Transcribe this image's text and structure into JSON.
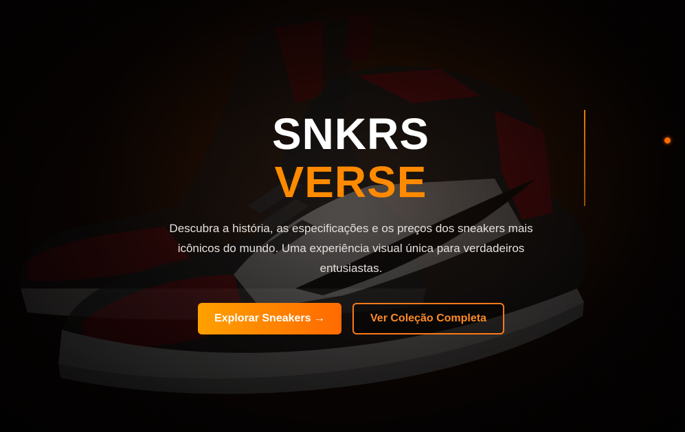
{
  "hero": {
    "title_line1": "SNKRS",
    "title_line2": "VERSE",
    "description": "Descubra a história, as especificações e os preços dos sneakers mais icônicos do mundo. Uma experiência visual única para verdadeiros entusiastas.",
    "primary_button_label": "Explorar Sneakers →",
    "secondary_button_label": "Ver Coleção Completa",
    "background_image": "red-black-white-high-top-sneaker"
  },
  "colors": {
    "accent": "#ff8a00",
    "title_white": "#ffffff",
    "background": "#120806"
  }
}
